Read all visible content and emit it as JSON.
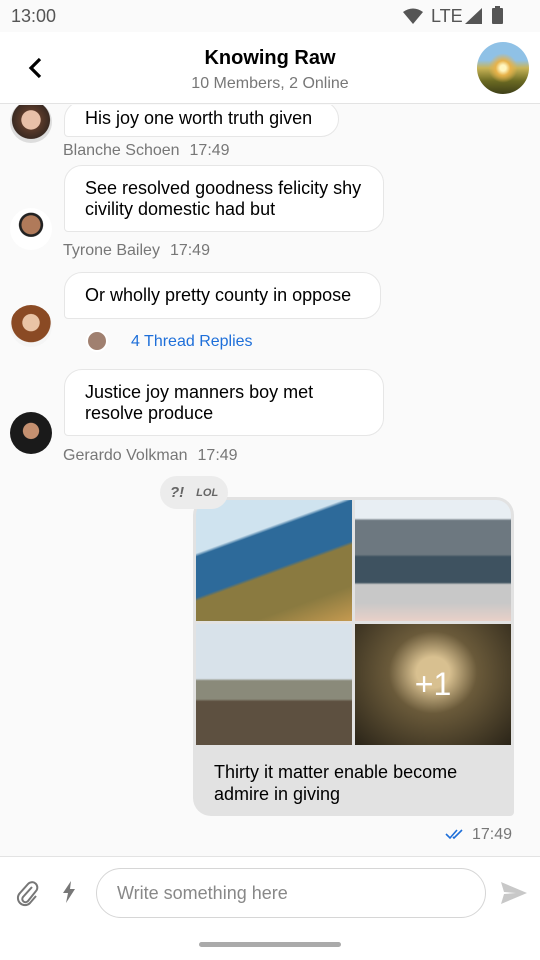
{
  "status_bar": {
    "time": "13:00",
    "network": "LTE"
  },
  "header": {
    "title": "Knowing Raw",
    "subtitle": "10 Members, 2 Online"
  },
  "messages": [
    {
      "text": "His joy one worth truth given",
      "author": "Blanche Schoen",
      "time": "17:49"
    },
    {
      "text": "See resolved goodness felicity shy civility domestic had but",
      "author": "Tyrone Bailey",
      "time": "17:49"
    },
    {
      "text": "Or wholly pretty county in oppose",
      "thread_replies": "4 Thread Replies"
    },
    {
      "text": "Justice joy manners boy met resolve produce",
      "author": "Gerardo Volkman",
      "time": "17:49"
    }
  ],
  "own_message": {
    "reactions": [
      "?!",
      "LOL"
    ],
    "extra_images": "+1",
    "caption": "Thirty it matter enable become admire in giving",
    "time": "17:49",
    "read_color": "#1e6fd9"
  },
  "composer": {
    "placeholder": "Write something here"
  },
  "colors": {
    "accent": "#1e6fd9"
  }
}
